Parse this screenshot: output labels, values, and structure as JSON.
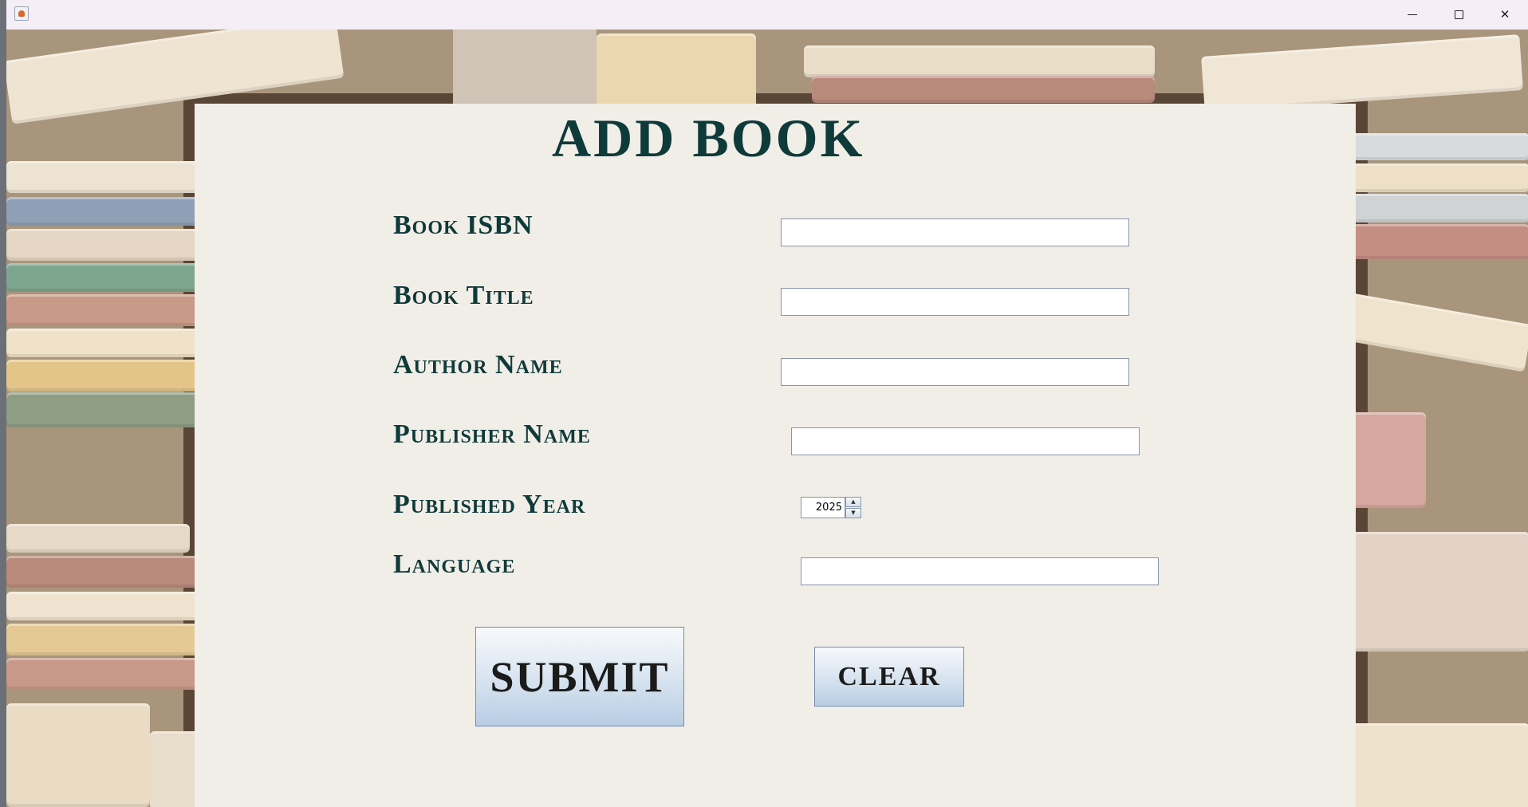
{
  "window": {
    "controls": {
      "minimize": "minimize-icon",
      "maximize": "maximize-icon",
      "close": "close-icon"
    },
    "app_icon": "java-cup-icon"
  },
  "form": {
    "title": "ADD BOOK",
    "fields": [
      {
        "label": "Book ISBN",
        "value": ""
      },
      {
        "label": "Book Title",
        "value": ""
      },
      {
        "label": "Author Name",
        "value": ""
      },
      {
        "label": "Publisher Name",
        "value": ""
      },
      {
        "label": "Published Year",
        "value": "2025"
      },
      {
        "label": "Language",
        "value": ""
      }
    ],
    "submit_label": "SUBMIT",
    "clear_label": "CLEAR"
  },
  "colors": {
    "label_text": "#0f3a3a",
    "paper": "#f1ede7",
    "button_gradient_top": "#f7f9fc",
    "button_gradient_bottom": "#b8cde4"
  }
}
